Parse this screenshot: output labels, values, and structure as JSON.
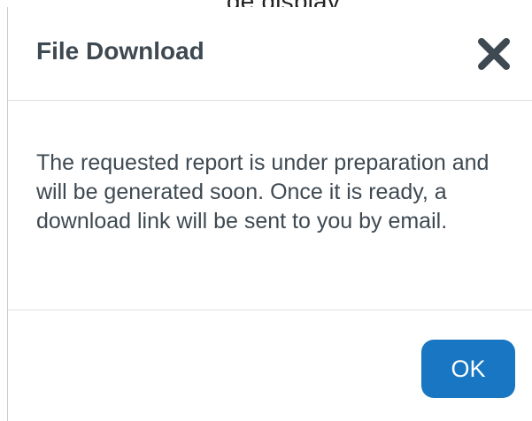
{
  "background_fragment": "...ge display...",
  "dialog": {
    "title": "File Download",
    "close_icon": "close-x-icon",
    "message": "The requested report is under preparation and will be generated soon. Once it is ready, a download link will be sent to you by email.",
    "ok_label": "OK"
  },
  "colors": {
    "title_text": "#3e4951",
    "body_text": "#3e4951",
    "primary_button": "#1976c2",
    "divider": "#dde1e4"
  }
}
